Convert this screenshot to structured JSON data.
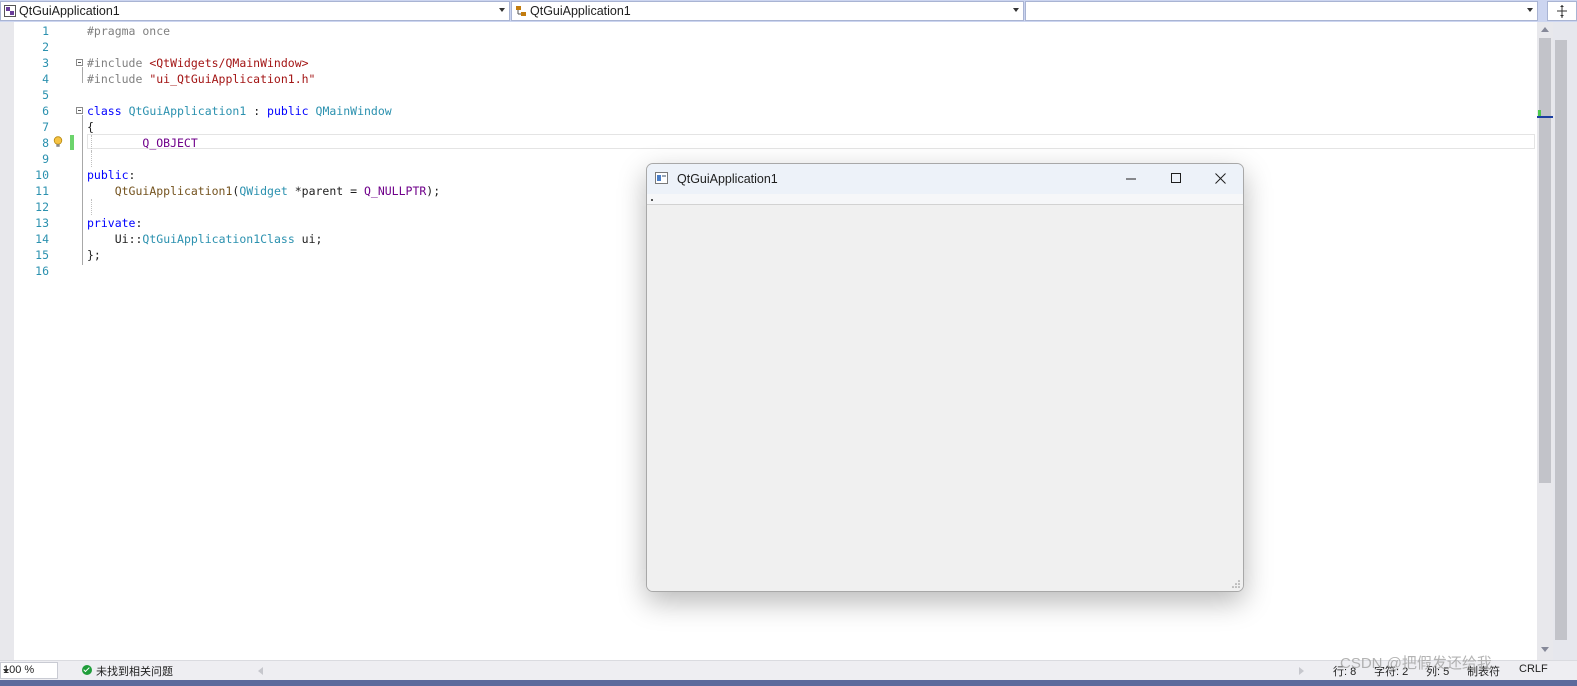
{
  "nav": {
    "scope": "QtGuiApplication1",
    "member": "QtGuiApplication1",
    "function": ""
  },
  "code_lines": [
    {
      "n": "1"
    },
    {
      "n": "2"
    },
    {
      "n": "3"
    },
    {
      "n": "4"
    },
    {
      "n": "5"
    },
    {
      "n": "6"
    },
    {
      "n": "7"
    },
    {
      "n": "8"
    },
    {
      "n": "9"
    },
    {
      "n": "10"
    },
    {
      "n": "11"
    },
    {
      "n": "12"
    },
    {
      "n": "13"
    },
    {
      "n": "14"
    },
    {
      "n": "15"
    },
    {
      "n": "16"
    }
  ],
  "code": {
    "l1": {
      "pp": "#pragma once"
    },
    "l3": {
      "pp": "#include ",
      "str": "<QtWidgets/QMainWindow>"
    },
    "l4": {
      "pp": "#include ",
      "str": "\"ui_QtGuiApplication1.h\""
    },
    "l6": {
      "kw1": "class",
      "ty1": "QtGuiApplication1",
      "sep": " : ",
      "kw2": "public",
      "ty2": "QMainWindow"
    },
    "l7": {
      "t": "{"
    },
    "l8": {
      "mac": "Q_OBJECT"
    },
    "l10": {
      "kw": "public",
      "p": ":"
    },
    "l11": {
      "fn": "QtGuiApplication1",
      "p1": "(",
      "ty": "QWidget",
      "p2": " *parent = ",
      "mac": "Q_NULLPTR",
      "p3": ");"
    },
    "l13": {
      "kw": "private",
      "p": ":"
    },
    "l14": {
      "t1": "Ui",
      "p1": "::",
      "ty": "QtGuiApplication1Class",
      "t2": " ui;"
    },
    "l15": {
      "t": "};"
    }
  },
  "status": {
    "zoom": "100 %",
    "issues": "未找到相关问题",
    "line": "行: 8",
    "char": "字符: 2",
    "col": "列: 5",
    "tabs": "制表符",
    "eol": "CRLF"
  },
  "qt_window": {
    "title": "QtGuiApplication1"
  },
  "watermark": "CSDN @把假发还给我",
  "colors": {
    "accent": "#5c6a9c",
    "line_number": "#2b91af",
    "keyword": "#0000ff",
    "type": "#2b91af",
    "string": "#a31515",
    "macro": "#6f008a"
  }
}
